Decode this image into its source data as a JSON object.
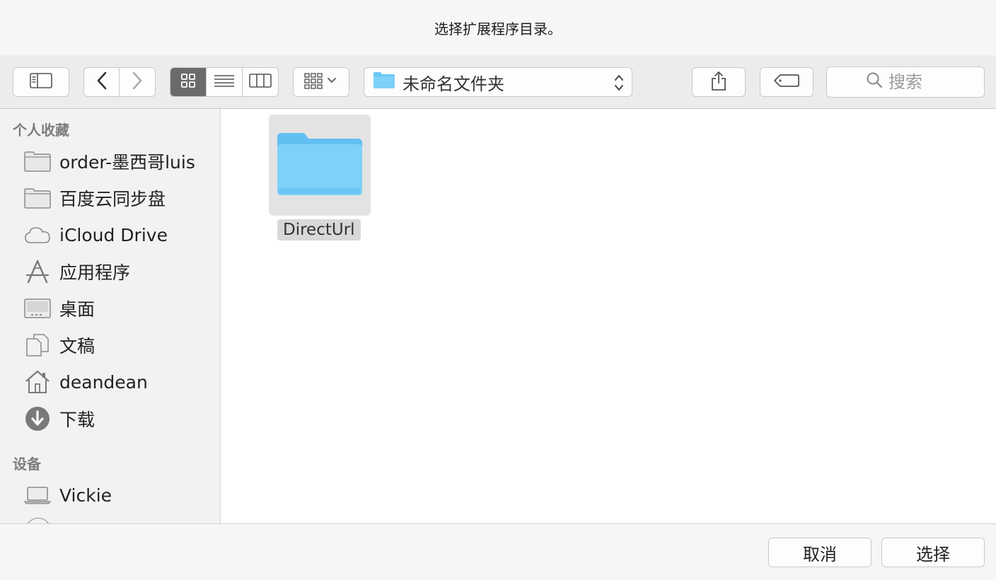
{
  "window": {
    "title": "选择扩展程序目录。"
  },
  "toolbar": {
    "path_folder": "未命名文件夹",
    "search_placeholder": "搜索"
  },
  "sidebar": {
    "favorites_title": "个人收藏",
    "favorites": [
      {
        "label": "order-墨西哥luis",
        "icon": "folder-icon"
      },
      {
        "label": "百度云同步盘",
        "icon": "folder-icon"
      },
      {
        "label": "iCloud Drive",
        "icon": "cloud-icon"
      },
      {
        "label": "应用程序",
        "icon": "applications-icon"
      },
      {
        "label": "桌面",
        "icon": "desktop-icon"
      },
      {
        "label": "文稿",
        "icon": "documents-icon"
      },
      {
        "label": "deandean",
        "icon": "home-icon"
      },
      {
        "label": "下载",
        "icon": "download-icon"
      }
    ],
    "devices_title": "设备",
    "devices": [
      {
        "label": "Vickie",
        "icon": "laptop-icon"
      }
    ]
  },
  "main": {
    "items": [
      {
        "name": "DirectUrl",
        "type": "folder",
        "selected": true
      }
    ]
  },
  "footer": {
    "cancel_label": "取消",
    "choose_label": "选择"
  },
  "colors": {
    "folder_blue": "#6cc6f5",
    "toolbar_bg": "#ececec",
    "active_segment": "#6b6b6b"
  }
}
